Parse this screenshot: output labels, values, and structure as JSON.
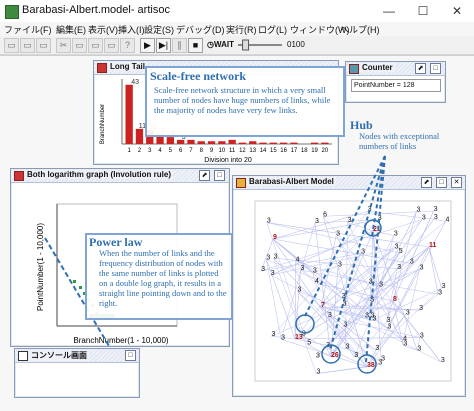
{
  "window": {
    "title": "Barabasi-Albert.model- artisoc",
    "min": "—",
    "max": "☐",
    "close": "✕"
  },
  "menu": [
    "ファイル(F)",
    "編集(E)",
    "表示(V)",
    "挿入(I)",
    "設定(S)",
    "デバッグ(D)",
    "実行(R)",
    "ログ(L)",
    "ウィンドウ(W)",
    "ヘルプ(H)"
  ],
  "toolbar": {
    "wait_label": "WAIT",
    "wait_value": "0100",
    "wait_level": 0.12
  },
  "long_tail": {
    "title": "Long Tail",
    "ylabel": "BranchNumber",
    "xlabel": "Division into 20"
  },
  "counter": {
    "title": "Counter",
    "value": "PointNumber = 128"
  },
  "both_log": {
    "title": "Both logarithm graph (Involution rule)",
    "ylabel": "PointNumber(1 - 10,000)",
    "xlabel": "BranchNumber(1 - 10,000)"
  },
  "ba_model": {
    "title": "Barabasi-Albert Model"
  },
  "console": {
    "title": "コンソール画面"
  },
  "annotations": {
    "scale_free_title": "Scale-free network",
    "scale_free_body": "Scale-free network structure in which a very small number of nodes have huge numbers of links, while the majority of nodes have very few links.",
    "hub_title": "Hub",
    "hub_body": "Nodes with exceptional numbers of links",
    "power_law_title": "Power law",
    "power_law_body": "When the number of links and the frequency distribution of nodes with the same number of links is plotted on a double log graph, it results in a straight line pointing down and to the right."
  },
  "chart_data": {
    "type": "bar",
    "title": "Long Tail",
    "xlabel": "Division into 20",
    "ylabel": "BranchNumber",
    "categories": [
      "1",
      "2",
      "3",
      "4",
      "5",
      "6",
      "7",
      "8",
      "9",
      "10",
      "11",
      "12",
      "13",
      "14",
      "15",
      "16",
      "17",
      "18",
      "19",
      "20"
    ],
    "values": [
      43,
      11,
      10,
      7,
      5,
      3,
      3,
      2,
      2,
      2,
      3,
      1,
      2,
      1,
      1,
      1,
      1,
      0,
      1,
      1
    ],
    "data_labels": [
      "43",
      "11",
      "10",
      "7",
      "5",
      "3"
    ],
    "ylim": [
      0,
      45
    ],
    "bar_color": "#cc2222",
    "xticks": [
      "1",
      "2",
      "3",
      "4",
      "5",
      "6",
      "7",
      "8",
      "9",
      "10",
      "11",
      "12",
      "13",
      "14",
      "15",
      "16",
      "17",
      "18",
      "19",
      "20"
    ]
  },
  "node_labels": [
    "3",
    "3",
    "3",
    "4",
    "3",
    "3",
    "3",
    "4",
    "3",
    "5",
    "3",
    "3",
    "3",
    "3",
    "3",
    "3",
    "3",
    "3",
    "3",
    "3",
    "4",
    "3",
    "3",
    "3",
    "3",
    "5",
    "3",
    "3",
    "3",
    "3",
    "3",
    "3",
    "3",
    "3",
    "6",
    "3",
    "3",
    "3",
    "3",
    "3",
    "3",
    "3",
    "4",
    "3",
    "3",
    "3",
    "3",
    "3",
    "3",
    "3",
    "3",
    "3",
    "3",
    "3",
    "3",
    "3",
    "3",
    "3",
    "3",
    "3",
    "3",
    "3"
  ],
  "hub_labels": [
    "21",
    "26",
    "38",
    "13",
    "9",
    "7",
    "11",
    "8"
  ],
  "colors": {
    "callout": "#2f6fb0",
    "edge": "#b9bff0",
    "bar": "#cc2222",
    "node": "#111111"
  }
}
